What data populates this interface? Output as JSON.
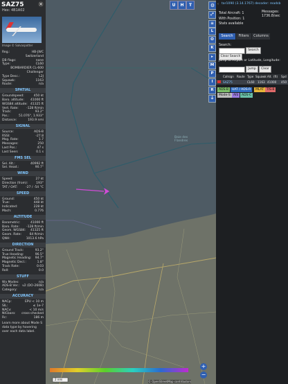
{
  "aircraft": {
    "callsign": "SAZ75",
    "hex_label": "Hex: 4B1A02",
    "image_credit": "Image © Salvaspotter",
    "details": [
      {
        "k": "Reg.:",
        "v": "HB-JWC"
      },
      {
        "k": "",
        "v": "Switzerland"
      },
      {
        "k": "DB flags:",
        "v": "none"
      },
      {
        "k": "Type:",
        "v": "CL60"
      },
      {
        "k": "",
        "v": "BOMBARDIER CL-600"
      },
      {
        "k": "",
        "v": "Challenger"
      },
      {
        "k": "Type Desc.:",
        "v": "L2J"
      },
      {
        "k": "Squawk:",
        "v": "1163"
      },
      {
        "k": "Route:",
        "v": "n/a"
      }
    ],
    "sections": [
      {
        "title": "SPATIAL",
        "rows": [
          {
            "k": "Groundspeed:",
            "v": "450 kt"
          },
          {
            "k": "Baro. altitude:",
            "v": "41000 ft"
          },
          {
            "k": "WGS84 altitude:",
            "v": "41325 ft"
          },
          {
            "k": "Vert. Rate:",
            "v": "-128 ft/min"
          },
          {
            "k": "Track:",
            "v": "93.2°"
          },
          {
            "k": "Pos.:",
            "v": "51.076°, 1.933°"
          },
          {
            "k": "Distance:",
            "v": "193.9 nmi"
          }
        ]
      },
      {
        "title": "SIGNAL",
        "rows": [
          {
            "k": "Source:",
            "v": "ADS-B"
          },
          {
            "k": "RSSI:",
            "v": "-27.8"
          },
          {
            "k": "Msg. Rate:",
            "v": "1.7"
          },
          {
            "k": "Messages:",
            "v": "250"
          },
          {
            "k": "Last Pos.:",
            "v": "47 s"
          },
          {
            "k": "Last Seen:",
            "v": "0.1 s"
          }
        ]
      },
      {
        "title": "FMS SEL",
        "rows": [
          {
            "k": "Sel. Alt.:",
            "v": "40992 ft"
          },
          {
            "k": "Sel. Head.:",
            "v": "90.7°"
          }
        ]
      },
      {
        "title": "WIND",
        "rows": [
          {
            "k": "Speed:",
            "v": "27 kt"
          },
          {
            "k": "Direction (from):",
            "v": "193°"
          },
          {
            "k": "TAT / OAT:",
            "v": "-27 / -54 °C"
          }
        ]
      },
      {
        "title": "SPEED",
        "rows": [
          {
            "k": "Ground:",
            "v": "450 kt"
          },
          {
            "k": "True:",
            "v": "448 kt"
          },
          {
            "k": "Indicated:",
            "v": "228 kt"
          },
          {
            "k": "Mach:",
            "v": "0.776"
          }
        ]
      },
      {
        "title": "ALTITUDE",
        "rows": [
          {
            "k": "Barometric:",
            "v": "41000 ft"
          },
          {
            "k": "Baro. Rate:",
            "v": "-128 ft/min"
          },
          {
            "k": "Geom. WGS84:",
            "v": "41325 ft"
          },
          {
            "k": "Geom. Rate:",
            "v": "64 ft/min"
          },
          {
            "k": "QNH:",
            "v": "1013.6 hPa"
          }
        ]
      },
      {
        "title": "DIRECTION",
        "rows": [
          {
            "k": "Ground Track:",
            "v": "93.2°"
          },
          {
            "k": "True Heading:",
            "v": "96.5°"
          },
          {
            "k": "Magnetic Heading:",
            "v": "94.7°"
          },
          {
            "k": "Magnetic Decl.:",
            "v": "1.8°"
          },
          {
            "k": "Track Rate:",
            "v": "0.03"
          },
          {
            "k": "Roll:",
            "v": "0.0"
          }
        ]
      },
      {
        "title": "STUFF",
        "rows": [
          {
            "k": "Wx Modes:",
            "v": "n/a"
          },
          {
            "k": "ADS-B Ver.:",
            "v": "v2 (DO-260B)"
          },
          {
            "k": "Category:",
            "v": "n/a"
          }
        ]
      },
      {
        "title": "ACCURACY",
        "rows": [
          {
            "k": "NACp:",
            "v": "EPU < 10 m"
          },
          {
            "k": "SIL:",
            "v": "≤ 1e-7"
          },
          {
            "k": "NACv:",
            "v": "< 10 m/s"
          },
          {
            "k": "NICbaro:",
            "v": "cross-checked"
          },
          {
            "k": "Rc:",
            "v": "186 m"
          }
        ]
      }
    ],
    "learn_more": "Learn more about Mode S data type by hovering over each data label."
  },
  "map": {
    "top_buttons": [
      "U",
      "H",
      "T"
    ],
    "side_buttons": [
      "L",
      "O",
      "K",
      "M",
      "P",
      "I",
      "R"
    ],
    "sea_label_1": "Baie des",
    "sea_label_2": "Flandres",
    "scale_label": "2 nmi",
    "attribution": "© OpenStreetMap contributors",
    "zoom_in": "+",
    "zoom_out": "−"
  },
  "panel": {
    "source_text": "tar1090 (3.14.1767) decoder: readsb",
    "total_aircraft": "Total Aircraft: 1",
    "with_position": "With Position: 1",
    "stats": "Stats available",
    "messages_label": "Messages:",
    "messages_rate": "1736.8/sec",
    "tabs": [
      "Search",
      "Filters",
      "Columns"
    ],
    "search_label": "Search:",
    "search_button": "Search",
    "clear_search": "Clear Search",
    "jump_label": "Jump to Airport or Latitude, Longitude:",
    "jump_button": "Jump",
    "clear_button": "Clear",
    "table_headers": [
      "Callsign",
      "Route",
      "Type",
      "Squawk",
      "Alt.",
      "(ft)",
      "Spd"
    ],
    "table_row": [
      "SAZ75",
      "",
      "CL60",
      "1163",
      "41000",
      "",
      "450"
    ],
    "legend": [
      "ADS-B",
      "UAT / ADS-R",
      "MLAT",
      "TIS-B",
      "Mode-S",
      "AIS",
      "ADS-C"
    ],
    "colors": {
      "adsb": "#7dbf6a",
      "uat": "#2f6cc0",
      "mlat": "#e8b63a",
      "tisb": "#e06a6a",
      "modes": "#bdbdbd",
      "ais": "#9a7adf",
      "adsc": "#6ac0a8"
    }
  }
}
